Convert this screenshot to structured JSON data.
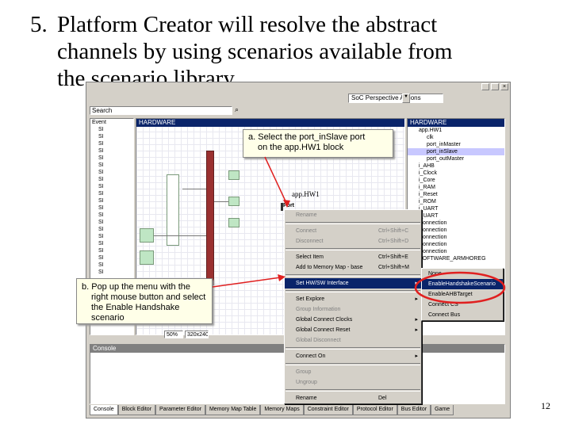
{
  "slide": {
    "title_number": "5.",
    "title_line1": "Platform Creator will resolve the abstract",
    "title_line2": "channels by using scenarios available from",
    "title_line3": "the scenario library",
    "page_number": "12"
  },
  "app": {
    "perspective_label": "SoC Perspective Actions",
    "search_label": "Search",
    "left_panel_header": "HARDWARE",
    "right_panel_header": "HARDWARE",
    "left_tree": [
      "Event",
      "SI",
      "SI",
      "SI",
      "SI",
      "SI",
      "SI",
      "SI",
      "SI",
      "SI",
      "SI",
      "SI",
      "SI",
      "SI",
      "SI",
      "SI",
      "SI",
      "SI",
      "SI",
      "SI",
      "SI",
      "SI"
    ],
    "right_tree": [
      "HARDWARE",
      "app.HW1",
      "clk",
      "port_inMaster",
      "port_inSlave",
      "port_outMaster",
      "i_AHB",
      "i_Clock",
      "i_Core",
      "i_RAM",
      "i_Reset",
      "i_ROM",
      "i_UART",
      "i_UART",
      "Connection",
      "Connection",
      "Connection",
      "Connection",
      "Connection",
      "SOFTWARE_ARMHOREG"
    ],
    "block_label": "app.HW1",
    "port_label": "Port",
    "zoom_value": "50%",
    "coord_value": "320x240",
    "console_header": "Console",
    "bottom_tabs": [
      "Console",
      "Block Editor",
      "Parameter Editor",
      "Memory Map Table",
      "Memory Maps",
      "Constraint Editor",
      "Protocol Editor",
      "Bus Editor",
      "Game"
    ]
  },
  "context_menu": {
    "items": [
      {
        "label": "Rename",
        "shortcut": "",
        "arrow": "",
        "state": "disabled"
      },
      {
        "label": "",
        "type": "separator"
      },
      {
        "label": "Connect",
        "shortcut": "Ctrl+Shift+C",
        "arrow": "",
        "state": "disabled"
      },
      {
        "label": "Disconnect",
        "shortcut": "Ctrl+Shift+D",
        "arrow": "",
        "state": "disabled"
      },
      {
        "label": "",
        "type": "separator"
      },
      {
        "label": "Select Item",
        "shortcut": "Ctrl+Shift+E",
        "arrow": "",
        "state": "normal"
      },
      {
        "label": "Add to Memory Map - base",
        "shortcut": "Ctrl+Shift+M",
        "arrow": "",
        "state": "normal"
      },
      {
        "label": "",
        "type": "separator"
      },
      {
        "label": "Set HW/SW Interface",
        "shortcut": "",
        "arrow": "▸",
        "state": "highlighted"
      },
      {
        "label": "",
        "type": "separator"
      },
      {
        "label": "Set Explore",
        "shortcut": "",
        "arrow": "▸",
        "state": "normal"
      },
      {
        "label": "Group Information",
        "shortcut": "",
        "arrow": "",
        "state": "disabled"
      },
      {
        "label": "Global Connect Clocks",
        "shortcut": "",
        "arrow": "▸",
        "state": "normal"
      },
      {
        "label": "Global Connect Reset",
        "shortcut": "",
        "arrow": "▸",
        "state": "normal"
      },
      {
        "label": "Global Disconnect",
        "shortcut": "",
        "arrow": "",
        "state": "disabled"
      },
      {
        "label": "",
        "type": "separator"
      },
      {
        "label": "Connect On",
        "shortcut": "",
        "arrow": "▸",
        "state": "normal"
      },
      {
        "label": "",
        "type": "separator"
      },
      {
        "label": "Group",
        "shortcut": "",
        "arrow": "",
        "state": "disabled"
      },
      {
        "label": "Ungroup",
        "shortcut": "",
        "arrow": "",
        "state": "disabled"
      },
      {
        "label": "",
        "type": "separator"
      },
      {
        "label": "Rename",
        "shortcut": "Del",
        "arrow": "",
        "state": "normal"
      }
    ],
    "submenu": [
      "None",
      "EnableHandshakeScenario",
      "EnableAHBTarget",
      "Connect CS",
      "Connect Bus"
    ]
  },
  "callouts": {
    "a_line1": "a. Select the port_inSlave port",
    "a_line2": "on the app.HW1 block",
    "b_line1": "b. Pop up the menu with the",
    "b_line2": "right mouse button and select",
    "b_line3": "the Enable Handshake scenario"
  },
  "colors": {
    "highlight": "#0a246a",
    "annotation": "#e02020",
    "block": "#bfe6c4",
    "window": "#d4d0c8"
  }
}
